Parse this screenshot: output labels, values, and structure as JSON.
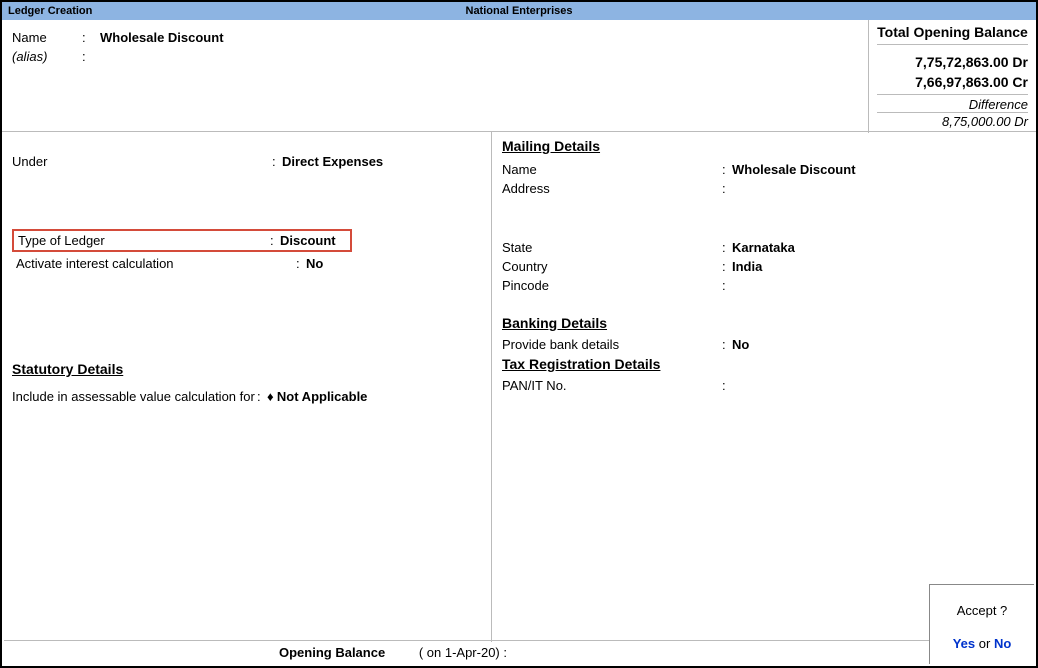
{
  "titlebar": {
    "left": "Ledger Creation",
    "center": "National Enterprises"
  },
  "header": {
    "name_label": "Name",
    "name_value": "Wholesale Discount",
    "alias_label": "(alias)",
    "alias_value": ""
  },
  "balance": {
    "title": "Total Opening Balance",
    "dr": "7,75,72,863.00 Dr",
    "cr": "7,66,97,863.00 Cr",
    "diff_label": "Difference",
    "diff_value": "8,75,000.00 Dr"
  },
  "left": {
    "under_label": "Under",
    "under_value": "Direct Expenses",
    "type_label": "Type of Ledger",
    "type_value": "Discount",
    "interest_label": "Activate interest calculation",
    "interest_value": "No",
    "stat_header": "Statutory Details",
    "include_label": "Include in assessable value calculation for",
    "include_value": "Not Applicable"
  },
  "right": {
    "mailing_header": "Mailing Details",
    "name_label": "Name",
    "name_value": "Wholesale Discount",
    "address_label": "Address",
    "address_value": "",
    "state_label": "State",
    "state_value": "Karnataka",
    "country_label": "Country",
    "country_value": "India",
    "pincode_label": "Pincode",
    "pincode_value": "",
    "banking_header": "Banking Details",
    "bank_label": "Provide bank details",
    "bank_value": "No",
    "tax_header": "Tax Registration Details",
    "pan_label": "PAN/IT No.",
    "pan_value": ""
  },
  "footer": {
    "opening_label": "Opening Balance",
    "opening_date": "( on 1-Apr-20)  :"
  },
  "accept": {
    "question": "Accept ?",
    "yes": "Yes",
    "or": " or ",
    "no": "No"
  }
}
